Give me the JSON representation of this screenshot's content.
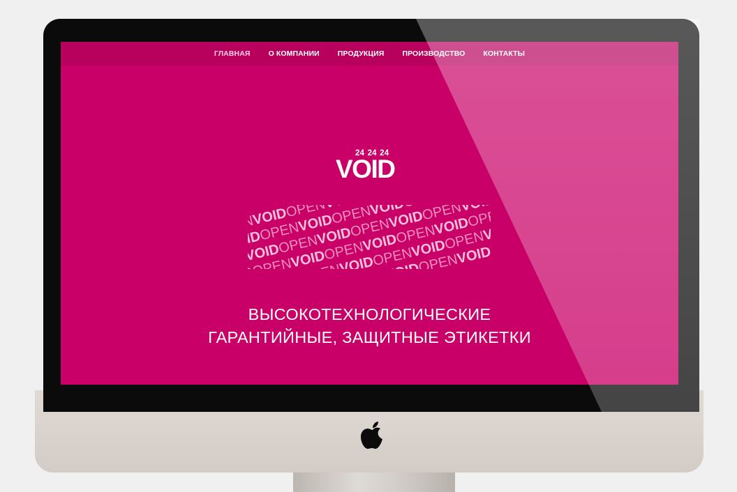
{
  "nav": {
    "items": [
      {
        "label": "ГЛАВНАЯ",
        "active": true
      },
      {
        "label": "О КОМПАНИИ",
        "active": false
      },
      {
        "label": "ПРОДУКЦИЯ",
        "active": false
      },
      {
        "label": "ПРОИЗВОДСТВО",
        "active": false
      },
      {
        "label": "КОНТАКТЫ",
        "active": false
      }
    ]
  },
  "logo": {
    "numbers": "24 24 24",
    "word": "VOID"
  },
  "pattern": {
    "word_open": "OPEN",
    "word_void": "VOID"
  },
  "hero": {
    "line1": "ВЫСОКОТЕХНОЛОГИЧЕСКИЕ",
    "line2": "ГАРАНТИЙНЫЕ, ЗАЩИТНЫЕ ЭТИКЕТКИ"
  },
  "colors": {
    "brand": "#c90067",
    "navbar": "#b8005d",
    "active_nav": "#ffd0e6"
  },
  "icons": {
    "device_logo": "apple-icon"
  }
}
